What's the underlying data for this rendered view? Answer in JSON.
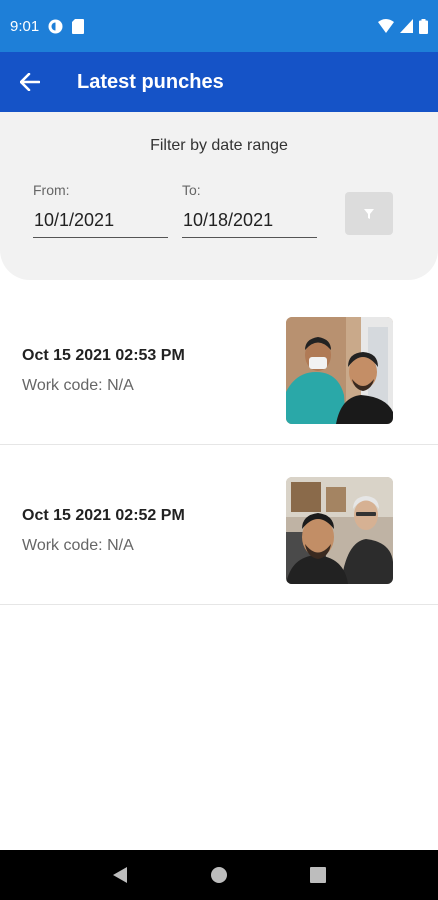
{
  "status_bar": {
    "time": "9:01"
  },
  "app_bar": {
    "title": "Latest punches"
  },
  "filter": {
    "title": "Filter by date range",
    "from_label": "From:",
    "from_value": "10/1/2021",
    "to_label": "To:",
    "to_value": "10/18/2021"
  },
  "punches": [
    {
      "date": "Oct 15 2021 02:53 PM",
      "work_code": "Work code: N/A"
    },
    {
      "date": "Oct 15 2021 02:52 PM",
      "work_code": "Work code: N/A"
    }
  ],
  "colors": {
    "status_bar": "#1e7fd8",
    "app_bar": "#1553c7",
    "filter_panel": "#f2f2f2",
    "nav_bar": "#000000"
  },
  "icons": {
    "back": "arrow-left-icon",
    "filter": "funnel-icon",
    "nav_back": "triangle-back-icon",
    "nav_home": "circle-home-icon",
    "nav_recents": "square-recents-icon"
  }
}
